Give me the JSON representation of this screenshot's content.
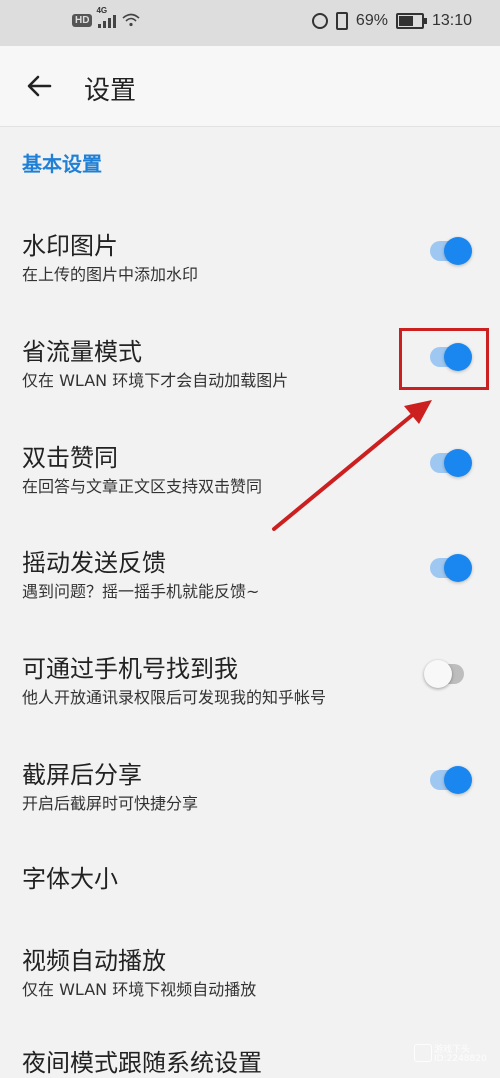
{
  "status_bar": {
    "hd": "HD",
    "network": "4G",
    "battery_percent": "69%",
    "battery_level": 0.69,
    "time": "13:10"
  },
  "header": {
    "title": "设置"
  },
  "section": {
    "title": "基本设置"
  },
  "settings": [
    {
      "title": "水印图片",
      "subtitle": "在上传的图片中添加水印",
      "toggle": "on"
    },
    {
      "title": "省流量模式",
      "subtitle": "仅在 WLAN 环境下才会自动加载图片",
      "toggle": "on"
    },
    {
      "title": "双击赞同",
      "subtitle": "在回答与文章正文区支持双击赞同",
      "toggle": "on"
    },
    {
      "title": "摇动发送反馈",
      "subtitle": "遇到问题？摇一摇手机就能反馈~",
      "toggle": "on"
    },
    {
      "title": "可通过手机号找到我",
      "subtitle": "他人开放通讯录权限后可发现我的知乎帐号",
      "toggle": "off"
    },
    {
      "title": "截屏后分享",
      "subtitle": "开启后截屏时可快捷分享",
      "toggle": "on"
    },
    {
      "title": "字体大小"
    },
    {
      "title": "视频自动播放",
      "subtitle": "仅在 WLAN 环境下视频自动播放"
    },
    {
      "title": "夜间模式跟随系统设置"
    }
  ],
  "watermark": {
    "line1": "游戏下头",
    "line2": "ID:2248820"
  },
  "colors": {
    "accent": "#1a87f0",
    "section_title": "#1f80d6",
    "annotation": "#cc1f1f"
  }
}
